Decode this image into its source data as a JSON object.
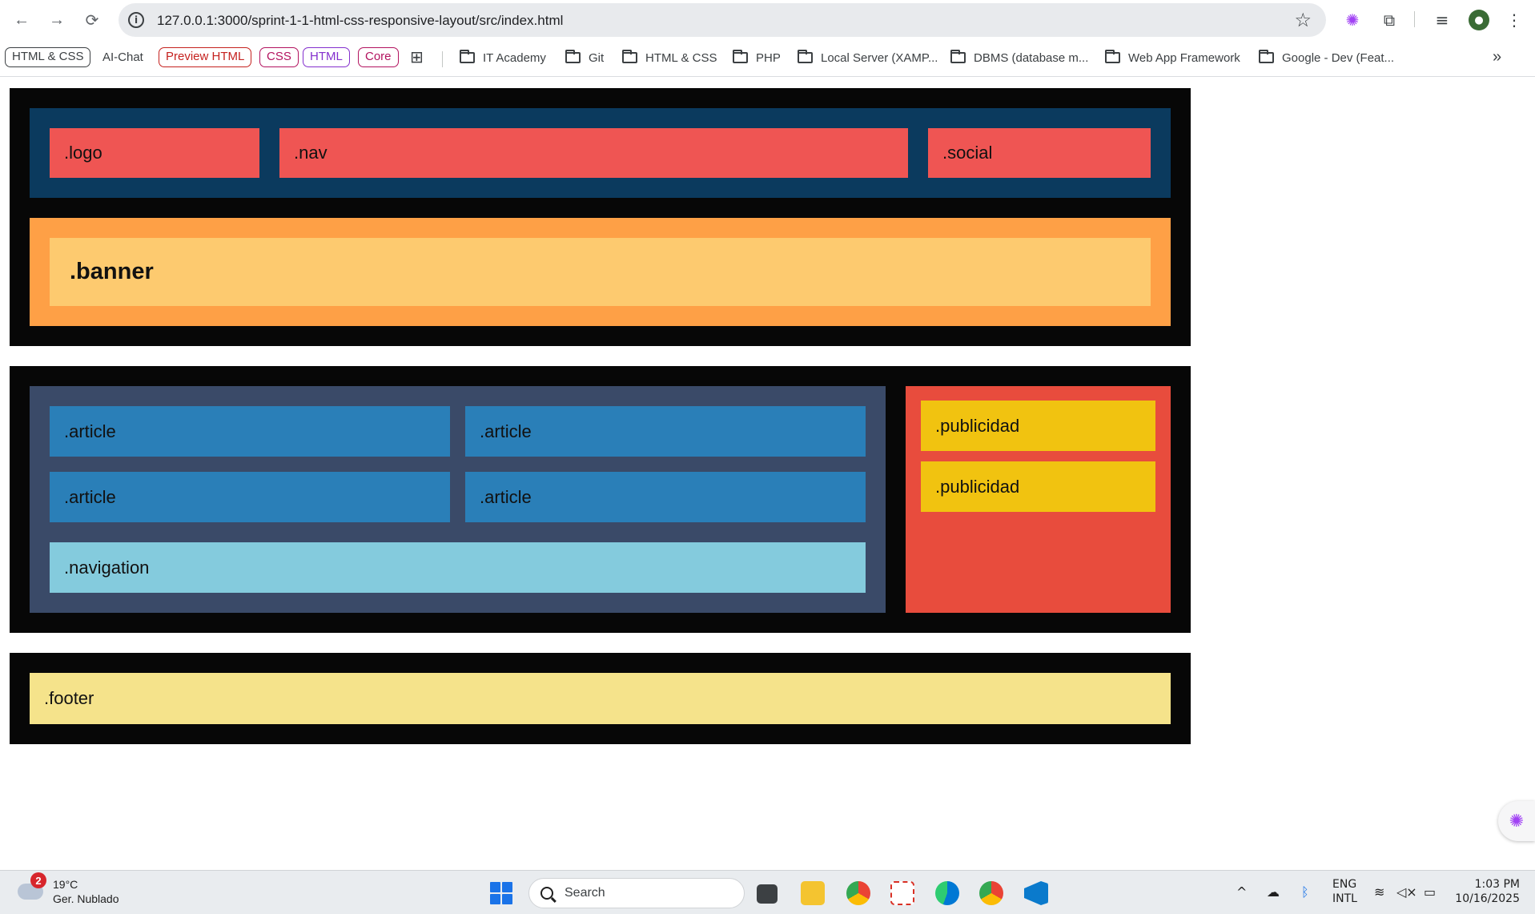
{
  "browser": {
    "url": "127.0.0.1:3000/sprint-1-1-html-css-responsive-layout/src/index.html"
  },
  "bookmarks": {
    "chips": [
      {
        "label": "HTML & CSS",
        "color": "#3c4043"
      },
      {
        "label": "AI-Chat",
        "color": "#3c4043"
      },
      {
        "label": "Preview HTML",
        "color": "#c5221f"
      },
      {
        "label": "CSS",
        "color": "#b3135f"
      },
      {
        "label": "HTML",
        "color": "#8430ce"
      },
      {
        "label": "Core",
        "color": "#b3135f"
      }
    ],
    "folders": [
      "IT Academy",
      "Git",
      "HTML & CSS",
      "PHP",
      "Local Server (XAMP...",
      "DBMS (database m...",
      "Web App Framework",
      "Google - Dev (Feat..."
    ],
    "overflow": "»"
  },
  "layout": {
    "header": {
      "logo": ".logo",
      "nav": ".nav",
      "social": ".social",
      "banner": ".banner"
    },
    "main": {
      "articles": [
        ".article",
        ".article",
        ".article",
        ".article"
      ],
      "navigation": ".navigation",
      "ads": [
        ".publicidad",
        ".publicidad"
      ]
    },
    "footer": ".footer"
  },
  "colors": {
    "frame": "#070707",
    "header_bg": "#0b3a5e",
    "header_items": "#ef5553",
    "banner_outer": "#fea046",
    "banner_inner": "#fdca6f",
    "main_bg": "#3a4a68",
    "article": "#2a7fb8",
    "navigation": "#84cbdd",
    "aside": "#e84c3d",
    "ad": "#f1c310",
    "footer": "#f5e38b"
  },
  "taskbar": {
    "weather_badge": "2",
    "temperature": "19°C",
    "condition": "Ger. Nublado",
    "search_placeholder": "Search",
    "lang_top": "ENG",
    "lang_bottom": "INTL",
    "time": "1:03 PM",
    "date": "10/16/2025"
  }
}
